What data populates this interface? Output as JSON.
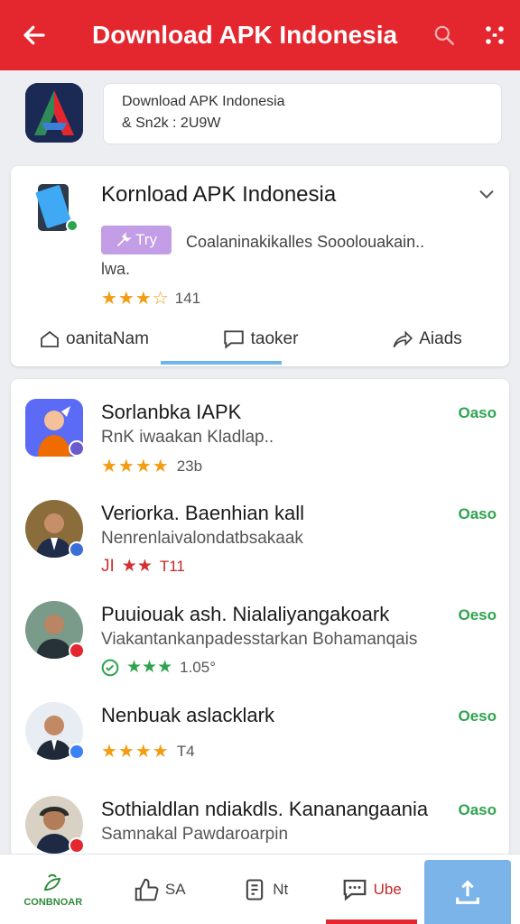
{
  "header": {
    "back_icon": "arrow-left-icon",
    "title": "Download APK Indonesia",
    "search_icon": "search-icon",
    "more_icon": "grid-dots-icon",
    "color": "#e4272f"
  },
  "app": {
    "logo": "app-logo",
    "line1": "Download APK Indonesia",
    "line2": "& Sn2k : 2U9W"
  },
  "featured": {
    "title": "Kornload APK Indonesia",
    "tag": "Try",
    "description": "Coalaninakikalles Sooolouakain..",
    "description2": "lwa.",
    "stars": "★★★☆",
    "rating_count": "141",
    "actions": [
      {
        "label": "oanitaNam",
        "icon": "home-outline-icon"
      },
      {
        "label": "taoker",
        "icon": "chat-bubble-icon"
      },
      {
        "label": "Aiads",
        "icon": "share-icon"
      }
    ]
  },
  "items": [
    {
      "name": "Sorlanbka IAPK",
      "sub": "RnK iwaakan Kladlap..",
      "stars": "★★★★",
      "rating": "23b",
      "free": "Oaso",
      "star_style": "gold"
    },
    {
      "name": "Veriorka. Baenhian kall",
      "sub": "Nenrenlaivalondatbsakaak",
      "stars": "★★",
      "rating": "T11",
      "prefix": "JI",
      "free": "Oaso",
      "star_style": "red"
    },
    {
      "name": "Puuiouak ash. Nialaliyangakoark",
      "sub": "Viakantankanpadesstarkan Bohamanqais",
      "stars": "★★★",
      "rating": "1.05°",
      "free": "Oeso",
      "star_style": "green"
    },
    {
      "name": "Nenbuak aslacklark",
      "sub": "",
      "stars": "★★★★",
      "rating": "T4",
      "free": "Oeso",
      "star_style": "gold"
    },
    {
      "name": "Sothialdlan ndiakdls. Kananangaania",
      "sub": "Samnakal Pawdaroarpin",
      "stars": "★★★★",
      "rating": "",
      "free": "Oaso",
      "star_style": "gold"
    }
  ],
  "bottom_nav": [
    {
      "label": "CONBNOAR",
      "icon": "home-leaf-icon"
    },
    {
      "label": "SA",
      "icon": "thumbs-up-icon"
    },
    {
      "label": "Nt",
      "icon": "document-icon"
    },
    {
      "label": "Ube",
      "icon": "chat-icon"
    },
    {
      "label": "",
      "icon": "upload-icon"
    }
  ]
}
